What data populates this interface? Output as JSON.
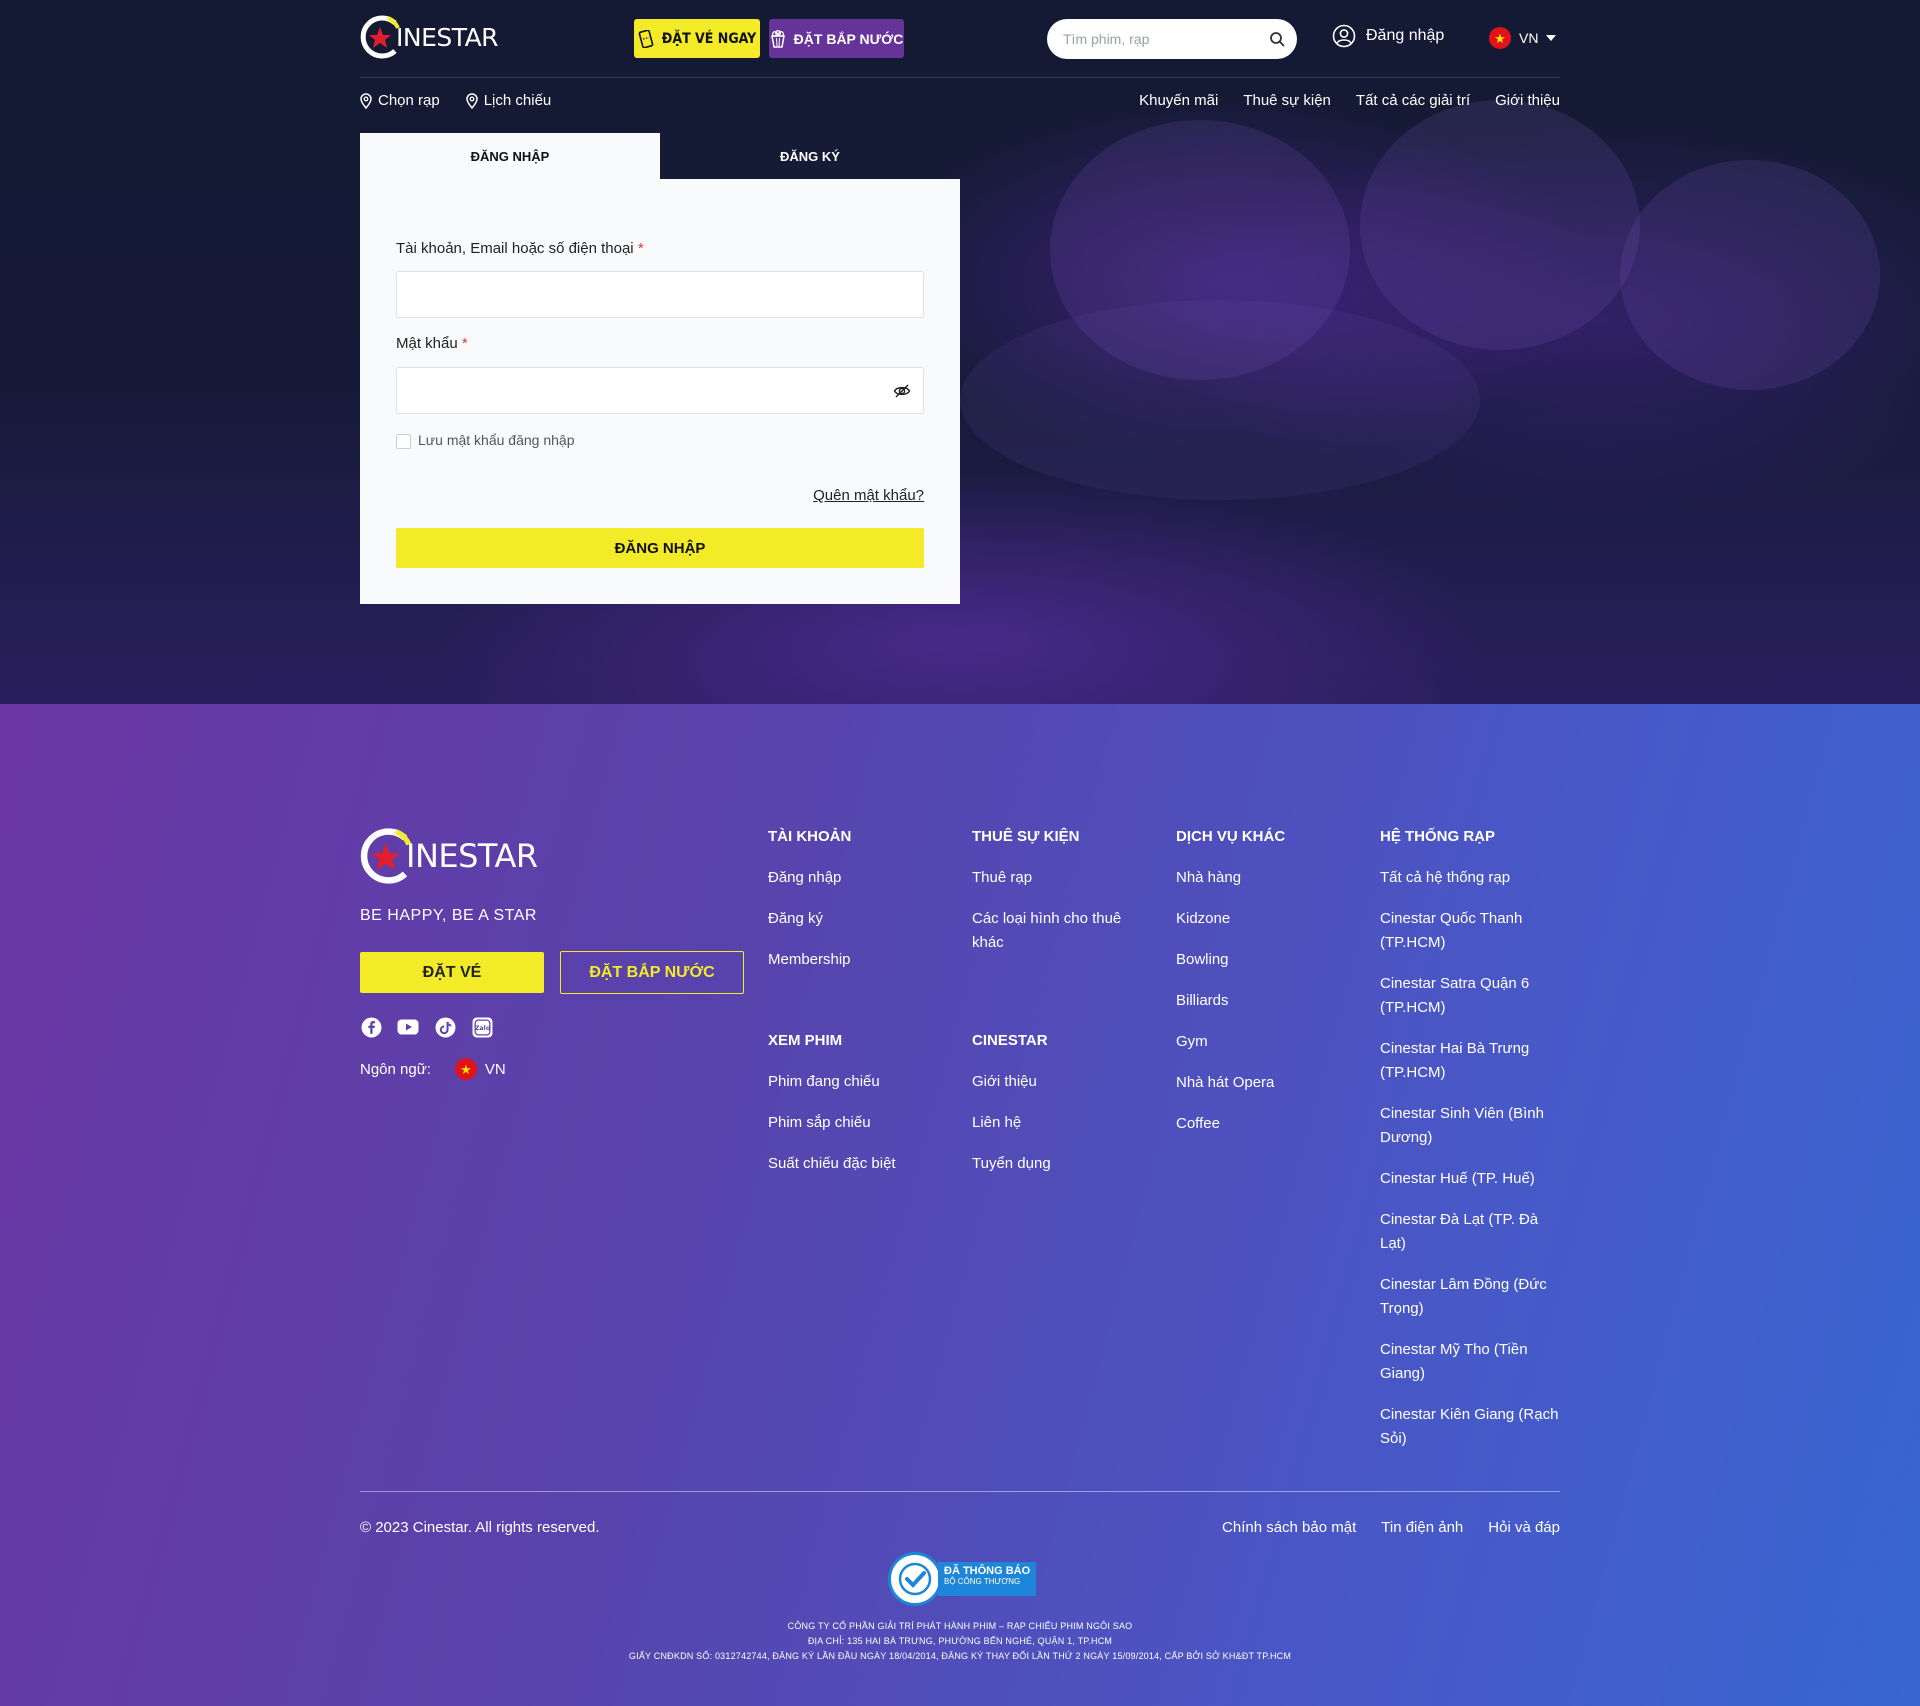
{
  "header": {
    "logo_text": "INESTAR",
    "ticket_button": "ĐẶT VÉ NGAY",
    "popcorn_button": "ĐẶT BẮP NƯỚC",
    "search_placeholder": "Tìm phim, rạp",
    "login_label": "Đăng nhập",
    "lang_label": "VN"
  },
  "subnav": {
    "left": [
      "Chọn rạp",
      "Lịch chiếu"
    ],
    "right": [
      "Khuyến mãi",
      "Thuê sự kiện",
      "Tất cả các giải trí",
      "Giới thiệu"
    ]
  },
  "auth": {
    "tab_login": "ĐĂNG NHẬP",
    "tab_register": "ĐĂNG KÝ",
    "account_label": "Tài khoản, Email hoặc số điện thoại",
    "password_label": "Mật khẩu",
    "required_mark": "*",
    "account_value": "",
    "password_value": "",
    "remember_label": "Lưu mật khẩu đăng nhập",
    "forgot_label": "Quên mật khẩu?",
    "submit_label": "ĐĂNG NHẬP"
  },
  "footer": {
    "logo_text": "INESTAR",
    "slogan": "BE HAPPY, BE A STAR",
    "ticket_button": "ĐẶT VÉ",
    "popcorn_button": "ĐẶT BẮP NƯỚC",
    "language_label": "Ngôn ngữ:",
    "language_value": "VN",
    "columns": {
      "account": {
        "title": "TÀI KHOẢN",
        "items": [
          "Đăng nhập",
          "Đăng ký",
          "Membership"
        ]
      },
      "events": {
        "title": "THUÊ SỰ KIỆN",
        "items": [
          "Thuê rạp",
          "Các loại hình cho thuê khác"
        ]
      },
      "services": {
        "title": "DỊCH VỤ KHÁC",
        "items": [
          "Nhà hàng",
          "Kidzone",
          "Bowling",
          "Billiards",
          "Gym",
          "Nhà hát Opera",
          "Coffee"
        ]
      },
      "cinemas": {
        "title": "HỆ THỐNG RẠP",
        "items": [
          "Tất cả hệ thống rạp",
          "Cinestar Quốc Thanh (TP.HCM)",
          "Cinestar Satra Quận 6 (TP.HCM)",
          "Cinestar Hai Bà Trưng (TP.HCM)",
          "Cinestar Sinh Viên (Bình Dương)",
          "Cinestar Huế (TP. Huế)",
          "Cinestar Đà Lạt (TP. Đà Lạt)",
          "Cinestar Lâm Đồng (Đức Trọng)",
          "Cinestar Mỹ Tho (Tiền Giang)",
          "Cinestar Kiên Giang (Rạch Sỏi)"
        ]
      },
      "movies": {
        "title": "XEM PHIM",
        "items": [
          "Phim đang chiếu",
          "Phim sắp chiếu",
          "Suất chiếu đặc biệt"
        ]
      },
      "cinestar": {
        "title": "CINESTAR",
        "items": [
          "Giới thiệu",
          "Liên hệ",
          "Tuyển dụng"
        ]
      }
    },
    "copyright": "© 2023 Cinestar. All rights reserved.",
    "bottom_links": [
      "Chính sách bảo mật",
      "Tin điện ảnh",
      "Hỏi và đáp"
    ],
    "badge": {
      "line1": "ĐÃ THÔNG BÁO",
      "line2": "BỘ CÔNG THƯƠNG"
    },
    "company_lines": [
      "CÔNG TY CỔ PHẦN GIẢI TRÍ PHÁT HÀNH PHIM – RẠP CHIẾU PHIM NGÔI SAO",
      "ĐỊA CHỈ: 135 HAI BÀ TRƯNG, PHƯỜNG BẾN NGHÉ, QUẬN 1, TP.HCM",
      "GIẤY CNĐKDN SỐ: 0312742744, ĐĂNG KÝ LẦN ĐẦU NGÀY 18/04/2014, ĐĂNG KÝ THAY ĐỔI LẦN THỨ 2 NGÀY 15/09/2014, CẤP BỞI SỞ KH&ĐT TP.HCM"
    ]
  },
  "colors": {
    "accent_yellow": "#f3ea28",
    "accent_purple": "#663399",
    "header_bg": "#141a33"
  }
}
